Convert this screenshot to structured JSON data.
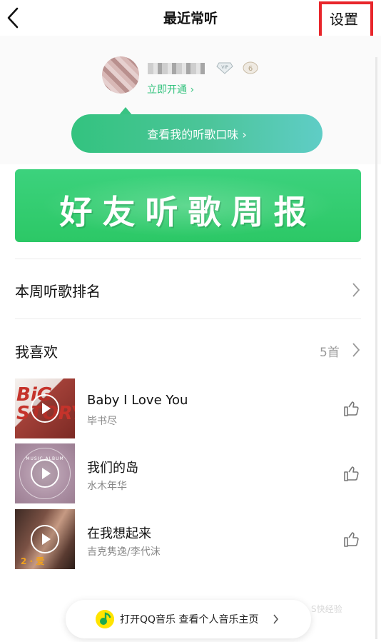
{
  "nav": {
    "title": "最近常听",
    "settings_label": "设置"
  },
  "profile": {
    "open_vip_link": "立即开通 ›"
  },
  "taste_button": {
    "label": "查看我的听歌口味 ›"
  },
  "banner": {
    "text": "好友听歌周报"
  },
  "weekly_rank": {
    "label": "本周听歌排名"
  },
  "favorites": {
    "label": "我喜欢",
    "count": "5首"
  },
  "songs": [
    {
      "title": "Baby I Love You",
      "artist": "毕书尽",
      "cover_text": "BiG STORY"
    },
    {
      "title": "我们的岛",
      "artist": "水木年华",
      "cover_text": "MUSIC ALBUM"
    },
    {
      "title": "在我想起来",
      "artist": "吉克隽逸/李代沫",
      "cover_text": "2 · 爱"
    }
  ],
  "bottom_bar": {
    "label": "打开QQ音乐  查看个人音乐主页"
  },
  "watermark": "S快经验",
  "colors": {
    "accent_green": "#31c27c",
    "annotation_red": "#e8262b"
  }
}
